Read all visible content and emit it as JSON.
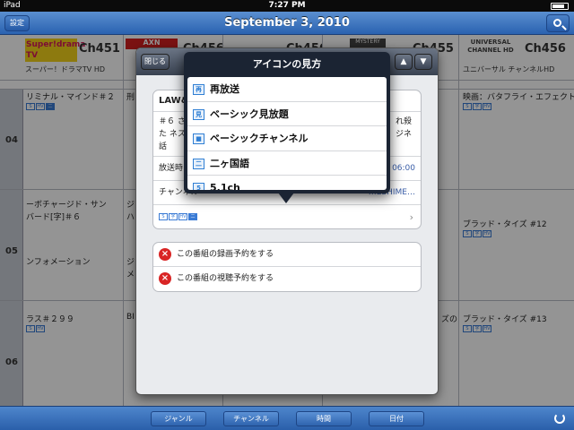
{
  "status": {
    "carrier": "iPad",
    "time": "7:27 PM"
  },
  "nav": {
    "settings_label": "設定",
    "title": "September 3, 2010"
  },
  "channels": [
    {
      "number": "Ch451",
      "name": "スーパー！ドラマTV HD",
      "logo": "Super!drama TV"
    },
    {
      "number": "Ch456",
      "name": "",
      "logo": "AXN"
    },
    {
      "number": "Ch456",
      "name": "",
      "logo": ""
    },
    {
      "number": "Ch455",
      "name": "",
      "logo": "MYSTERY"
    },
    {
      "number": "Ch456",
      "name": "ユニバーサル チャンネルHD",
      "logo": "UNIVERSAL CHANNEL HD"
    }
  ],
  "hours": [
    "04",
    "05",
    "06"
  ],
  "grid": {
    "col1": [
      "リミナル・マインド＃２",
      "ーボチャージド・サン",
      "バード[字]＃６",
      "ンフォメーション",
      "ラス＃２９９"
    ],
    "col2": [
      "刑",
      "ジ",
      "ハ",
      "ジ",
      "メ",
      "BI"
    ],
    "col5": [
      "映画：バタフライ・エフェクト",
      "ブラッド・タイズ #12",
      "ブラッド・タイズ #13"
    ],
    "col4_snip": [
      "ズの"
    ]
  },
  "icons": {
    "s": "S",
    "ji": "字",
    "hv": "HV",
    "ni": "二"
  },
  "toolbar": {
    "genre": "ジャンル",
    "channel": "チャンネル",
    "time": "時間",
    "date": "日付"
  },
  "modal": {
    "close_label": "閉じる",
    "up_label": "▲",
    "down_label": "▼",
    "detail": {
      "program": "LAW&",
      "description": "＃６ された ネスの話",
      "desc_right": "れ殺 ジネ",
      "broadcast_label": "放送時",
      "broadcast_time": "06:00",
      "channel_label": "チャンネル",
      "channel_value": "…ESHIME…"
    },
    "actions": [
      "この番組の録画予約をする",
      "この番組の視聴予約をする"
    ]
  },
  "popover": {
    "title": "アイコンの見方",
    "items": [
      {
        "icon": "再",
        "label": "再放送"
      },
      {
        "icon": "見",
        "label": "ベーシック見放題"
      },
      {
        "icon": "■",
        "label": "ベーシックチャンネル"
      },
      {
        "icon": "二",
        "label": "二ヶ国語"
      },
      {
        "icon": "5",
        "label": "5.1ch"
      }
    ]
  },
  "colors": {
    "nav": "#2a62b0",
    "popover": "#1b2433",
    "accent": "#3a7bd5",
    "danger": "#d92525"
  }
}
